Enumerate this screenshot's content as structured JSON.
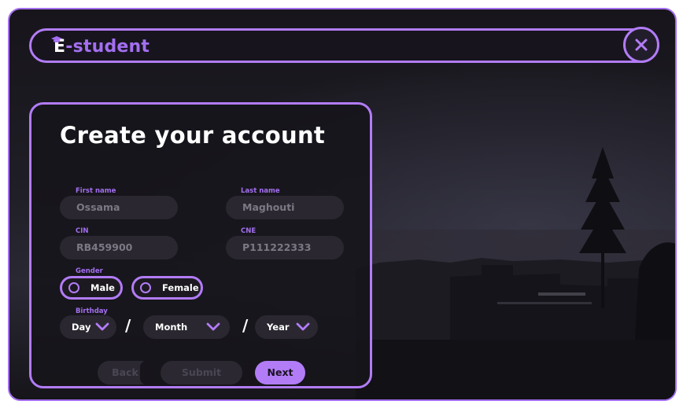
{
  "app": {
    "logo_prefix": "E",
    "logo_rest": "-student"
  },
  "form": {
    "title": "Create your account",
    "first_name": {
      "label": "First name",
      "value": "Ossama"
    },
    "last_name": {
      "label": "Last name",
      "value": "Maghouti"
    },
    "cin": {
      "label": "CIN",
      "value": "RB459900"
    },
    "cne": {
      "label": "CNE",
      "value": "P111222333"
    },
    "gender": {
      "label": "Gender",
      "options": [
        "Male",
        "Female"
      ]
    },
    "birthday": {
      "label": "Birthday",
      "day": "Day",
      "month": "Month",
      "year": "Year",
      "separator": "/"
    },
    "buttons": {
      "back": "Back",
      "submit": "Submit",
      "next": "Next"
    }
  },
  "theme": {
    "accent": "#b27cf7",
    "background": "#17151b",
    "field": "#2a2730"
  },
  "icons": [
    "graduation-cap-icon",
    "close-icon",
    "radio-icon",
    "chevron-down-icon"
  ]
}
